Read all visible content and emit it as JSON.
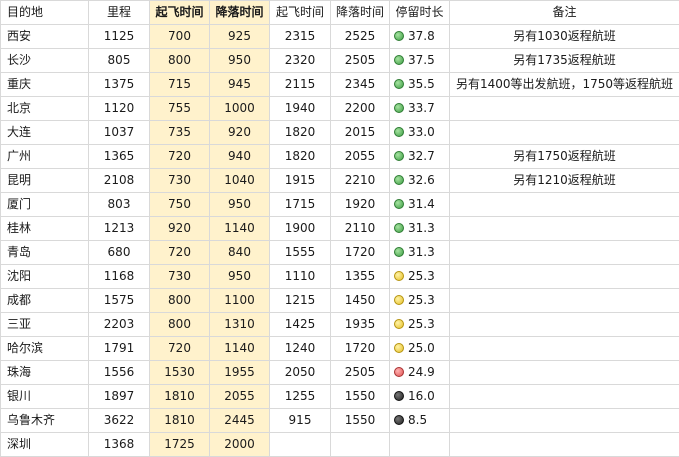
{
  "headers": {
    "dest": "目的地",
    "distance": "里程",
    "dep1": "起飞时间",
    "arr1": "降落时间",
    "dep2": "起飞时间",
    "arr2": "降落时间",
    "stay": "停留时长",
    "note": "备注"
  },
  "colors": {
    "highlight": "#fff2cc",
    "green": "#3f9f45",
    "yellow": "#e6c02a",
    "red": "#e05252",
    "black": "#222222"
  },
  "rows": [
    {
      "dest": "西安",
      "distance": "1125",
      "dep1": "700",
      "arr1": "925",
      "dep2": "2315",
      "arr2": "2525",
      "stay": "37.8",
      "status": "green",
      "status_icon": "green-circle-icon",
      "note": "另有1030返程航班"
    },
    {
      "dest": "长沙",
      "distance": "805",
      "dep1": "800",
      "arr1": "950",
      "dep2": "2320",
      "arr2": "2505",
      "stay": "37.5",
      "status": "green",
      "status_icon": "green-circle-icon",
      "note": "另有1735返程航班"
    },
    {
      "dest": "重庆",
      "distance": "1375",
      "dep1": "715",
      "arr1": "945",
      "dep2": "2115",
      "arr2": "2345",
      "stay": "35.5",
      "status": "green",
      "status_icon": "green-circle-icon",
      "note": "另有1400等出发航班，1750等返程航班"
    },
    {
      "dest": "北京",
      "distance": "1120",
      "dep1": "755",
      "arr1": "1000",
      "dep2": "1940",
      "arr2": "2200",
      "stay": "33.7",
      "status": "green",
      "status_icon": "green-circle-icon",
      "note": ""
    },
    {
      "dest": "大连",
      "distance": "1037",
      "dep1": "735",
      "arr1": "920",
      "dep2": "1820",
      "arr2": "2015",
      "stay": "33.0",
      "status": "green",
      "status_icon": "green-circle-icon",
      "note": ""
    },
    {
      "dest": "广州",
      "distance": "1365",
      "dep1": "720",
      "arr1": "940",
      "dep2": "1820",
      "arr2": "2055",
      "stay": "32.7",
      "status": "green",
      "status_icon": "green-circle-icon",
      "note": "另有1750返程航班"
    },
    {
      "dest": "昆明",
      "distance": "2108",
      "dep1": "730",
      "arr1": "1040",
      "dep2": "1915",
      "arr2": "2210",
      "stay": "32.6",
      "status": "green",
      "status_icon": "green-circle-icon",
      "note": "另有1210返程航班"
    },
    {
      "dest": "厦门",
      "distance": "803",
      "dep1": "750",
      "arr1": "950",
      "dep2": "1715",
      "arr2": "1920",
      "stay": "31.4",
      "status": "green",
      "status_icon": "green-circle-icon",
      "note": ""
    },
    {
      "dest": "桂林",
      "distance": "1213",
      "dep1": "920",
      "arr1": "1140",
      "dep2": "1900",
      "arr2": "2110",
      "stay": "31.3",
      "status": "green",
      "status_icon": "green-circle-icon",
      "note": ""
    },
    {
      "dest": "青岛",
      "distance": "680",
      "dep1": "720",
      "arr1": "840",
      "dep2": "1555",
      "arr2": "1720",
      "stay": "31.3",
      "status": "green",
      "status_icon": "green-circle-icon",
      "note": ""
    },
    {
      "dest": "沈阳",
      "distance": "1168",
      "dep1": "730",
      "arr1": "950",
      "dep2": "1110",
      "arr2": "1355",
      "stay": "25.3",
      "status": "yellow",
      "status_icon": "yellow-circle-icon",
      "note": ""
    },
    {
      "dest": "成都",
      "distance": "1575",
      "dep1": "800",
      "arr1": "1100",
      "dep2": "1215",
      "arr2": "1450",
      "stay": "25.3",
      "status": "yellow",
      "status_icon": "yellow-circle-icon",
      "note": ""
    },
    {
      "dest": "三亚",
      "distance": "2203",
      "dep1": "800",
      "arr1": "1310",
      "dep2": "1425",
      "arr2": "1935",
      "stay": "25.3",
      "status": "yellow",
      "status_icon": "yellow-circle-icon",
      "note": ""
    },
    {
      "dest": "哈尔滨",
      "distance": "1791",
      "dep1": "720",
      "arr1": "1140",
      "dep2": "1240",
      "arr2": "1720",
      "stay": "25.0",
      "status": "yellow",
      "status_icon": "yellow-circle-icon",
      "note": ""
    },
    {
      "dest": "珠海",
      "distance": "1556",
      "dep1": "1530",
      "arr1": "1955",
      "dep2": "2050",
      "arr2": "2505",
      "stay": "24.9",
      "status": "red",
      "status_icon": "red-circle-icon",
      "note": ""
    },
    {
      "dest": "银川",
      "distance": "1897",
      "dep1": "1810",
      "arr1": "2055",
      "dep2": "1255",
      "arr2": "1550",
      "stay": "16.0",
      "status": "black",
      "status_icon": "black-circle-icon",
      "note": ""
    },
    {
      "dest": "乌鲁木齐",
      "distance": "3622",
      "dep1": "1810",
      "arr1": "2445",
      "dep2": "915",
      "arr2": "1550",
      "stay": "8.5",
      "status": "black",
      "status_icon": "black-circle-icon",
      "note": ""
    },
    {
      "dest": "深圳",
      "distance": "1368",
      "dep1": "1725",
      "arr1": "2000",
      "dep2": "",
      "arr2": "",
      "stay": "",
      "status": "",
      "status_icon": "",
      "note": ""
    }
  ]
}
